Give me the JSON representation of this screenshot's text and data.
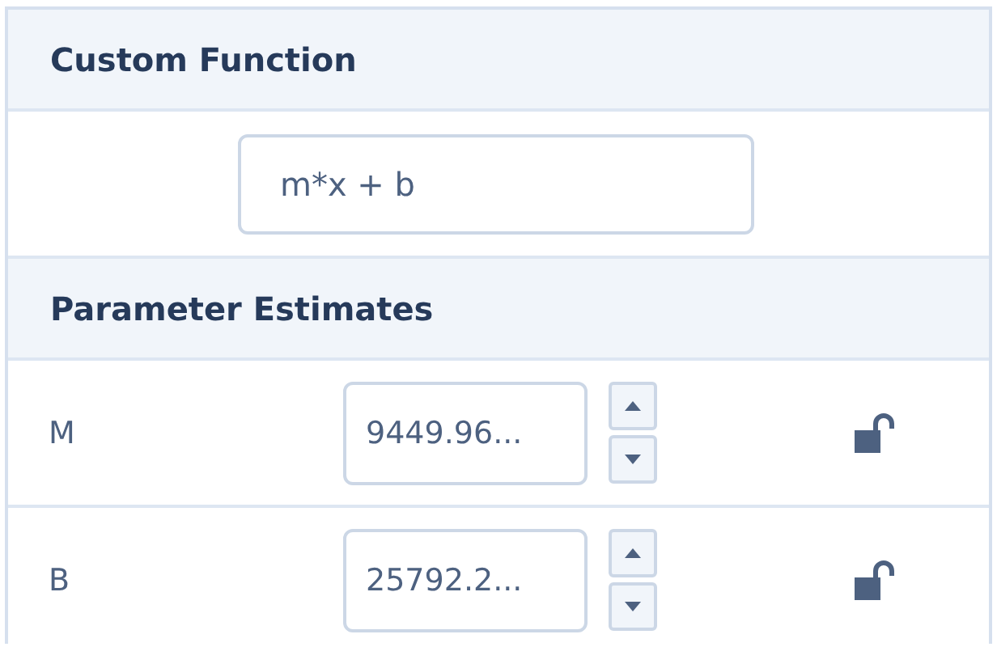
{
  "custom_function": {
    "title": "Custom Function",
    "value": "m*x + b"
  },
  "parameter_estimates": {
    "title": "Parameter Estimates",
    "rows": [
      {
        "name": "M",
        "value": "9449.96...",
        "locked": false
      },
      {
        "name": "B",
        "value": "25792.2...",
        "locked": false
      }
    ]
  }
}
